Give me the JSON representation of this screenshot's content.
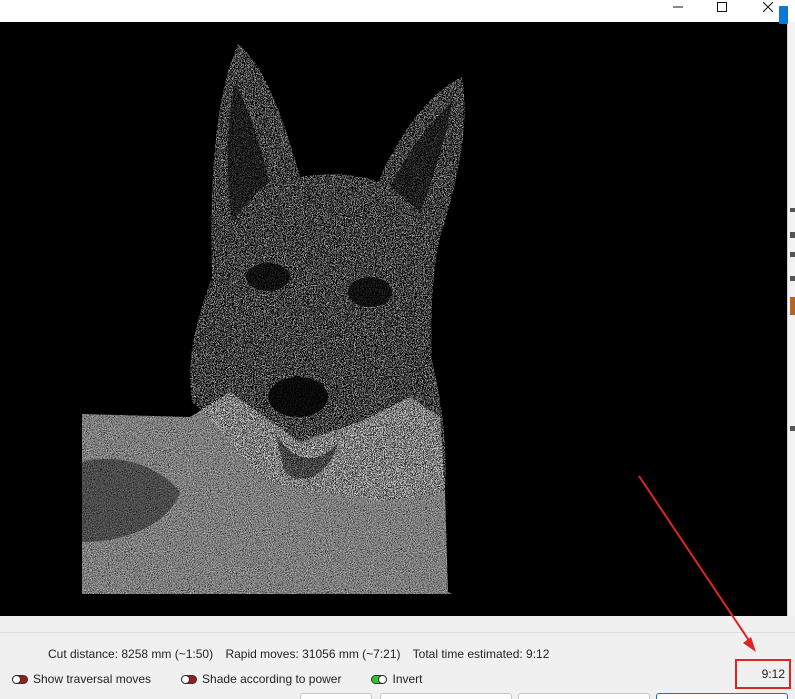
{
  "window": {
    "controls": {
      "minimize": "minimize",
      "maximize": "maximize",
      "close": "close"
    }
  },
  "preview": {
    "subject": "German Shepherd dog portrait (dithered engraving preview)",
    "background_color": "#000000",
    "foreground_color": "#ffffff"
  },
  "stats": {
    "cut_distance": "Cut distance: 8258 mm (~1:50)",
    "rapid_moves": "Rapid moves: 31056 mm (~7:21)",
    "total_time": "Total time estimated: 9:12"
  },
  "toggles": [
    {
      "label": "Show traversal moves",
      "state": "off"
    },
    {
      "label": "Shade according to power",
      "state": "off"
    },
    {
      "label": "Invert",
      "state": "on"
    }
  ],
  "time_display": "9:12",
  "colors": {
    "accent": "#0a78d7",
    "toggle_off": "#9b1c1c",
    "toggle_on": "#2ec43a",
    "annotation": "#e02424"
  }
}
